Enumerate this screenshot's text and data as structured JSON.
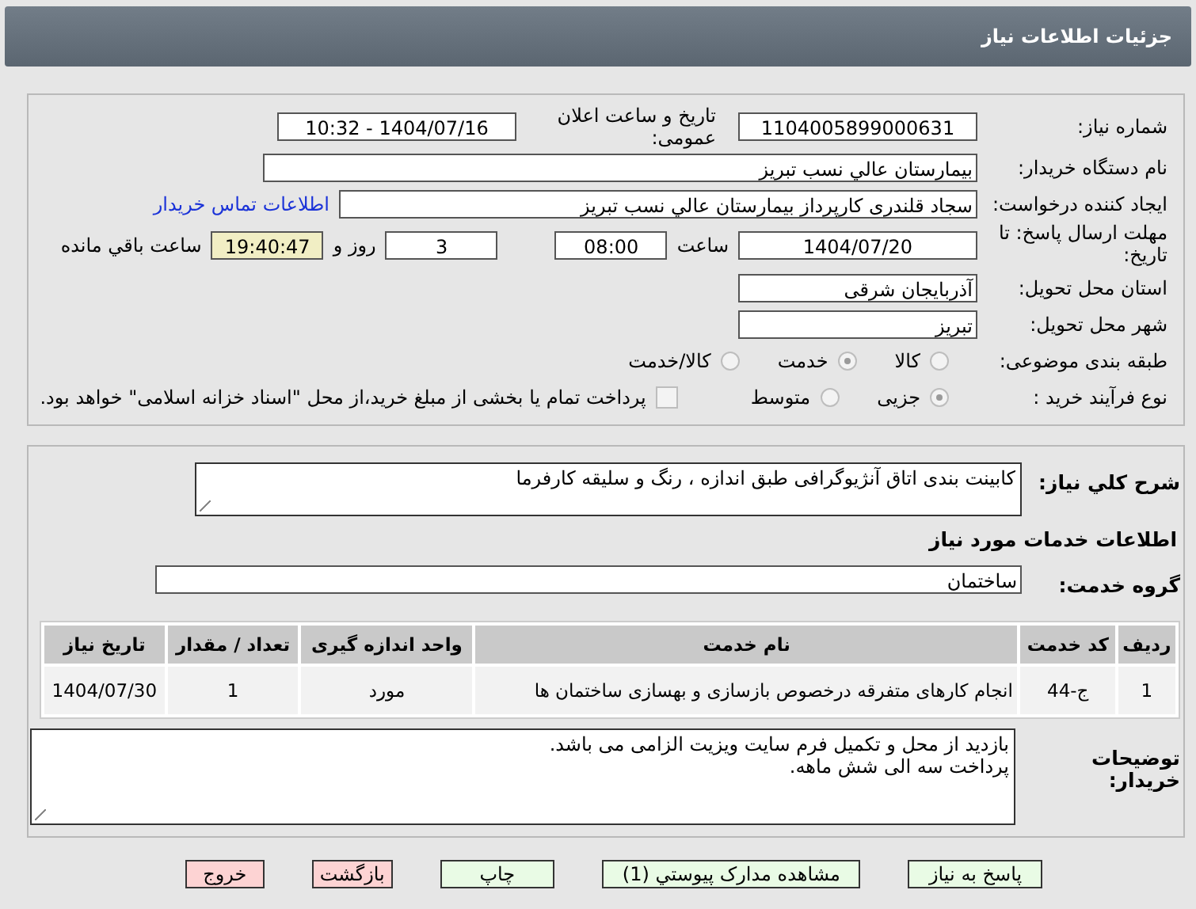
{
  "header": {
    "title": "جزئیات اطلاعات نیاز"
  },
  "details": {
    "need_number_label": "شماره نیاز:",
    "need_number": "1104005899000631",
    "announce_label": "تاریخ و ساعت اعلان عمومی:",
    "announce_value": "1404/07/16 - 10:32",
    "buyer_label": "نام دستگاه خریدار:",
    "buyer": "بیمارستان عالي نسب تبریز",
    "creator_label": "ایجاد کننده درخواست:",
    "creator": "سجاد قلندری کارپرداز بیمارستان عالي نسب تبریز",
    "contact_link": "اطلاعات تماس خریدار",
    "deadline_label": "مهلت ارسال پاسخ: تا تاریخ:",
    "deadline_date": "1404/07/20",
    "time_label": "ساعت",
    "deadline_time": "08:00",
    "days": "3",
    "days_label": "روز و",
    "remaining": "19:40:47",
    "remaining_label": "ساعت باقي مانده",
    "province_label": "استان محل تحویل:",
    "province": "آذربایجان شرقی",
    "city_label": "شهر محل تحویل:",
    "city": "تبریز",
    "category_label": "طبقه بندی موضوعی:",
    "category_options": [
      {
        "label": "کالا",
        "selected": false
      },
      {
        "label": "خدمت",
        "selected": true
      },
      {
        "label": "کالا/خدمت",
        "selected": false
      }
    ],
    "process_label": "نوع فرآیند خرید :",
    "process_options": [
      {
        "label": "جزیی",
        "selected": true
      },
      {
        "label": "متوسط",
        "selected": false
      }
    ],
    "payment_checkbox": {
      "label": "پرداخت تمام یا بخشی از مبلغ خرید،از محل \"اسناد خزانه اسلامی\" خواهد بود.",
      "checked": false
    }
  },
  "services": {
    "description_label": "شرح کلي نیاز:",
    "description": "کابینت بندی اتاق آنژیوگرافی طبق اندازه ، رنگ و سلیقه کارفرما",
    "section_title": "اطلاعات خدمات مورد نیاز",
    "group_label": "گروه خدمت:",
    "group": "ساختمان",
    "table": {
      "columns": [
        "ردیف",
        "کد خدمت",
        "نام خدمت",
        "واحد اندازه گیری",
        "تعداد / مقدار",
        "تاریخ نیاز"
      ],
      "rows": [
        [
          "1",
          "ج-44",
          "انجام کارهای متفرقه درخصوص بازسازی و بهسازی ساختمان ها",
          "مورد",
          "1",
          "1404/07/30"
        ]
      ]
    },
    "notes_label": "توضیحات خریدار:",
    "notes": [
      "بازدید از محل و تکمیل فرم سایت ویزیت الزامی می باشد.",
      "پرداخت سه الی شش ماهه."
    ]
  },
  "buttons": [
    {
      "label": "پاسخ به نیاز",
      "kind": "action"
    },
    {
      "label": "مشاهده مدارک پیوستي (1)",
      "kind": "action"
    },
    {
      "label": "چاپ",
      "kind": "action"
    },
    {
      "label": "بازگشت",
      "kind": "exit"
    },
    {
      "label": "خروج",
      "kind": "exit"
    }
  ]
}
